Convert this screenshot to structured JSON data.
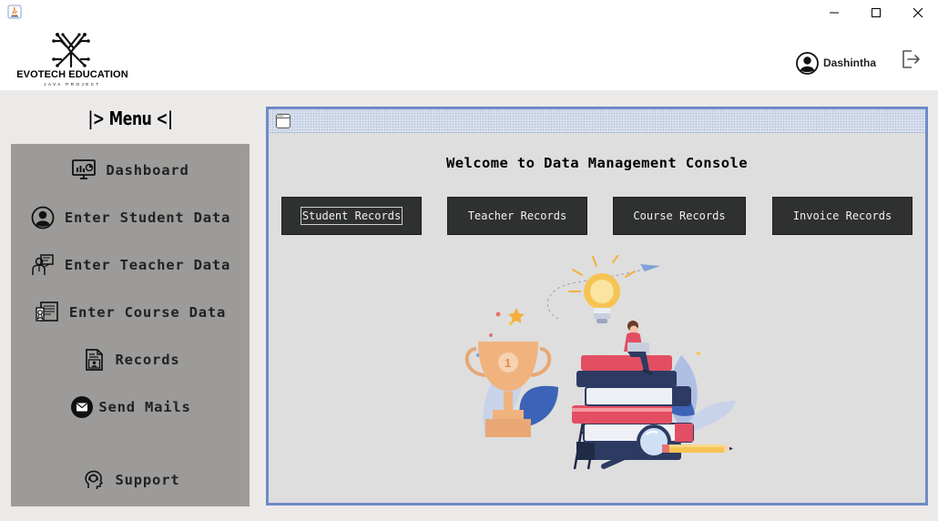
{
  "window": {
    "controls": [
      "minimize-icon",
      "maximize-icon",
      "close-icon"
    ]
  },
  "header": {
    "brand_title": "EVOTECH EDUCATION",
    "brand_subtitle": "JAVA PROJECT",
    "user_name": "Dashintha"
  },
  "sidebar": {
    "title": "|> Menu <|",
    "items": [
      {
        "label": "Dashboard",
        "icon": "dashboard-monitor-icon"
      },
      {
        "label": "Enter Student Data",
        "icon": "student-user-icon"
      },
      {
        "label": "Enter Teacher Data",
        "icon": "teacher-icon"
      },
      {
        "label": "Enter Course Data",
        "icon": "course-certificate-icon"
      },
      {
        "label": "Records",
        "icon": "records-document-icon"
      },
      {
        "label": "Send Mails",
        "icon": "mail-icon"
      },
      {
        "label": "Support",
        "icon": "support-headset-icon"
      }
    ]
  },
  "console": {
    "heading": "Welcome to Data Management Console",
    "buttons": [
      {
        "label": "Student Records",
        "focused": true
      },
      {
        "label": "Teacher Records",
        "focused": false
      },
      {
        "label": "Course Records",
        "focused": false
      },
      {
        "label": "Invoice Records",
        "focused": false
      }
    ],
    "illustration": "education-books-illustration"
  },
  "colors": {
    "sidebar_bg": "#9c9b9a",
    "content_bg": "#eceae9",
    "frame_border": "#6f8bc6",
    "button_bg": "#2f3030"
  }
}
